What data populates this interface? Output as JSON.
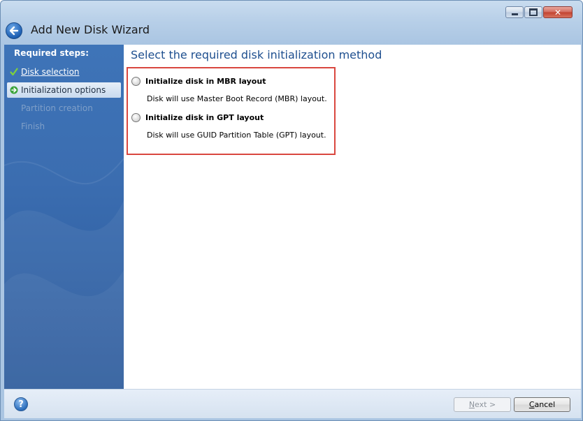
{
  "window": {
    "title": "Add New Disk Wizard",
    "close_glyph": "✕"
  },
  "sidebar": {
    "heading": "Required steps:",
    "steps": [
      {
        "label": "Disk selection",
        "state": "done",
        "icon": "checkmark-icon"
      },
      {
        "label": "Initialization options",
        "state": "current",
        "icon": "arrow-right-icon"
      },
      {
        "label": "Partition creation",
        "state": "pending"
      },
      {
        "label": "Finish",
        "state": "pending"
      }
    ]
  },
  "main": {
    "title": "Select the required disk initialization method",
    "options": [
      {
        "label": "Initialize disk in MBR layout",
        "description": "Disk will use Master Boot Record (MBR) layout.",
        "selected": false
      },
      {
        "label": "Initialize disk in GPT layout",
        "description": "Disk will use GUID Partition Table (GPT) layout.",
        "selected": false
      }
    ]
  },
  "footer": {
    "help_glyph": "?",
    "next_label_mnemonic": "N",
    "next_label_rest": "ext >",
    "next_enabled": false,
    "cancel_label_mnemonic": "C",
    "cancel_label_rest": "ancel"
  },
  "colors": {
    "sidebar_top": "#3e74b8",
    "sidebar_bottom": "#27579a",
    "title_text": "#1e4f8f",
    "highlight_border": "#d9473f"
  }
}
